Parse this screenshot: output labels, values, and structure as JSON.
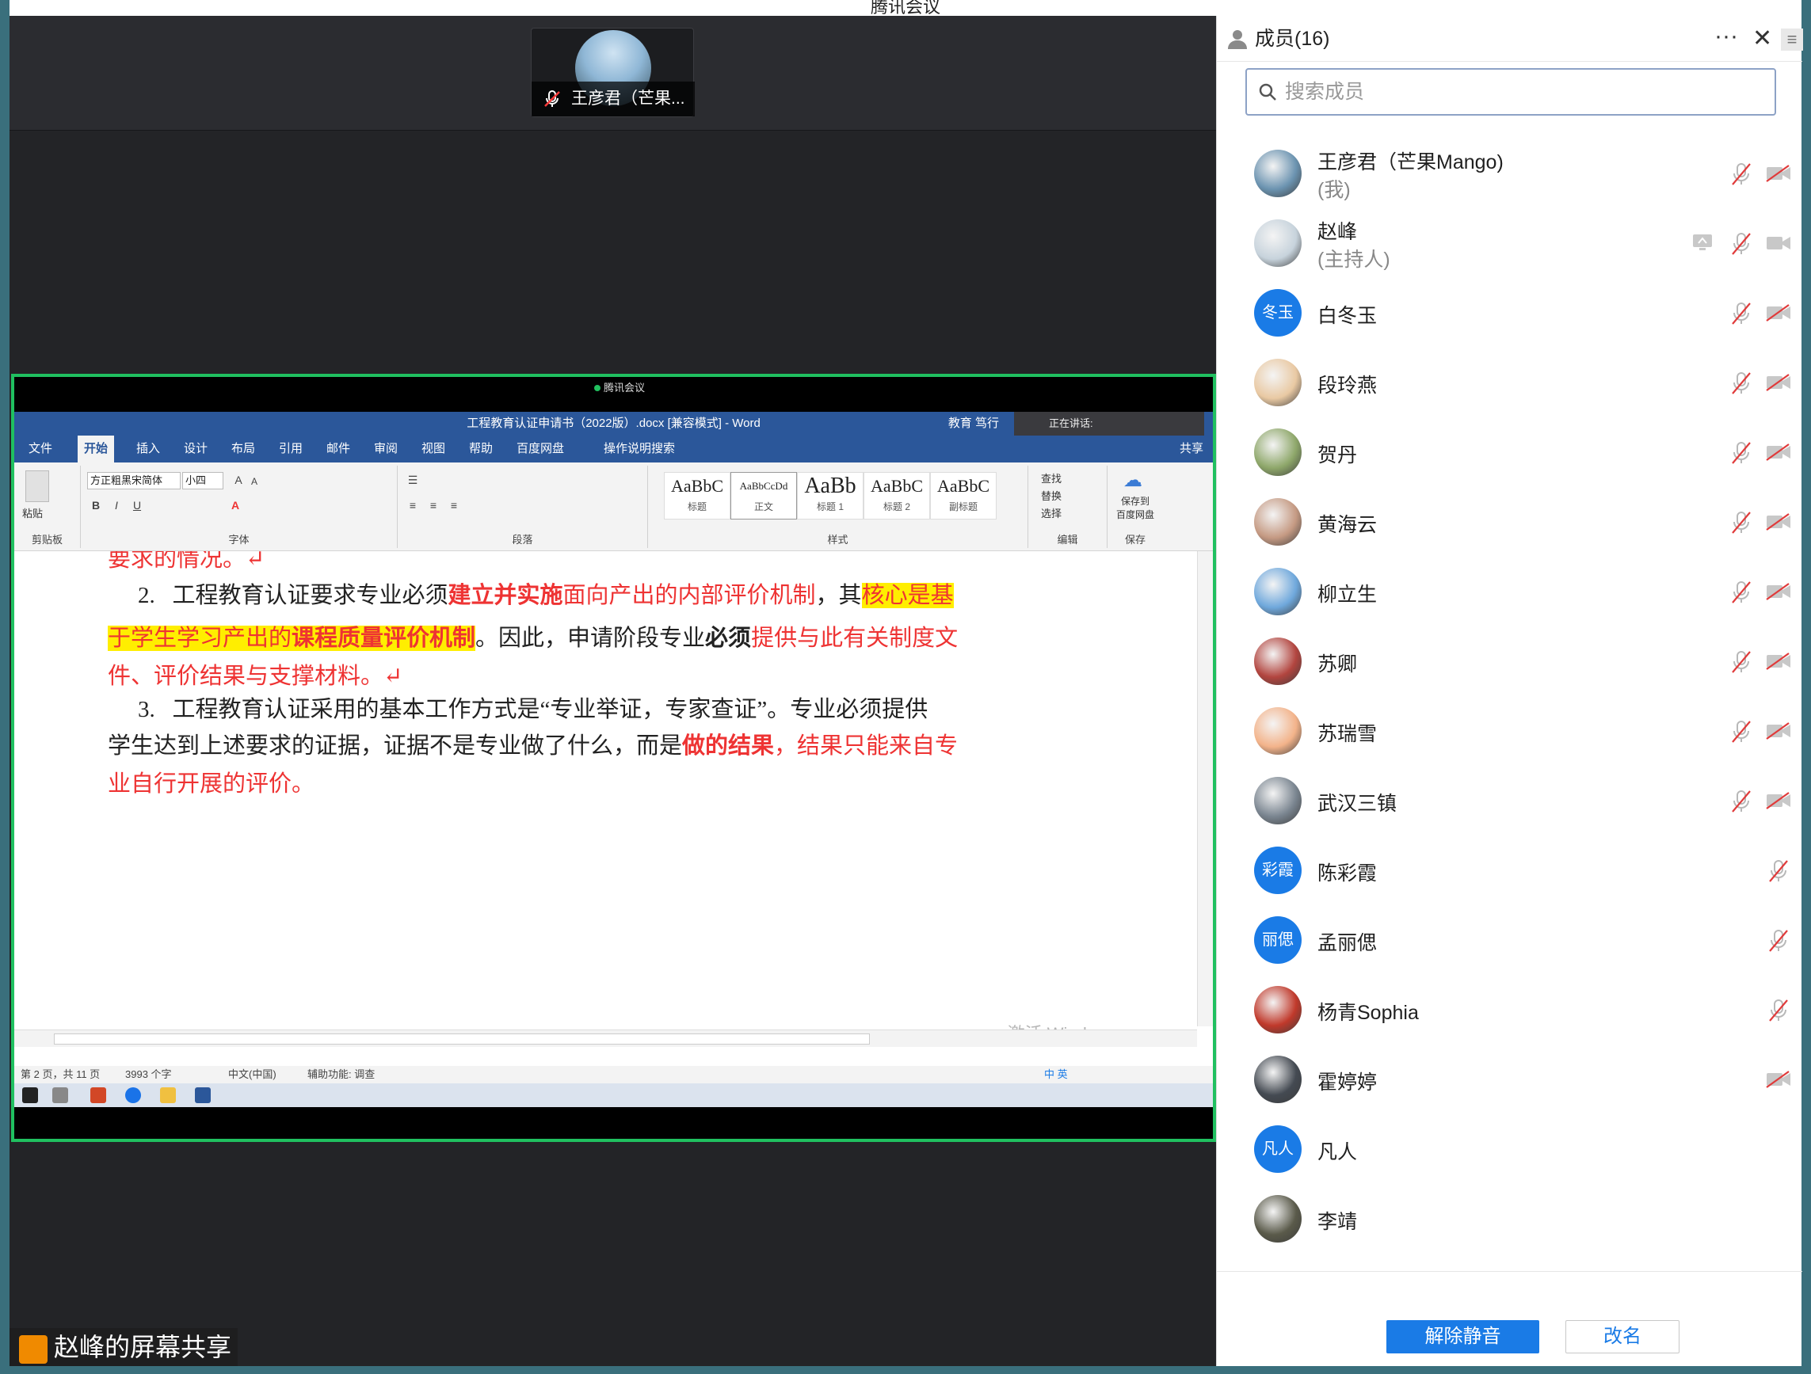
{
  "window": {
    "title": "腾讯会议"
  },
  "video_tile": {
    "name": "王彦君（芒果..."
  },
  "share": {
    "badge": "腾讯会议",
    "word_title": "工程教育认证申请书（2022版）.docx [兼容模式] - Word",
    "word_user": "教育 笃行",
    "speaking": "正在讲话:",
    "tabs": [
      "文件",
      "开始",
      "插入",
      "设计",
      "布局",
      "引用",
      "邮件",
      "审阅",
      "视图",
      "帮助",
      "百度网盘",
      "操作说明搜索"
    ],
    "share_btn": "共享",
    "ribbon": {
      "paste": "粘贴",
      "clipboard": "剪贴板",
      "font_name": "方正粗黑宋简体",
      "font_size": "小四",
      "font_group": "字体",
      "para_group": "段落",
      "styles_group": "样式",
      "edit_group": "编辑",
      "save_group": "保存",
      "styles": [
        {
          "preview": "AaBbC",
          "name": "标题"
        },
        {
          "preview": "AaBbCcDd",
          "name": "正文"
        },
        {
          "preview": "AaBb",
          "name": "标题 1"
        },
        {
          "preview": "AaBbC",
          "name": "标题 2"
        },
        {
          "preview": "AaBbC",
          "name": "副标题"
        }
      ],
      "find": "查找",
      "replace": "替换",
      "select": "选择",
      "save_to": "保存到\n百度网盘"
    },
    "doc": {
      "l0": "要求的情况。↵",
      "l1_num": "2.",
      "l1_a": "工程教育认证要求专业必须",
      "l1_b": "建立并实施",
      "l1_c": "面向产出的内部评价机制",
      "l1_d": "，其",
      "l1_e": "核心是基",
      "l2_a": "于学生学习产出的",
      "l2_b": "课程质量评价机制",
      "l2_c": "。因此，申请阶段专业",
      "l2_d": "必须",
      "l2_e": "提供与此有关制度文",
      "l3": "件、评价结果与支撑材料。↵",
      "l4_num": "3.",
      "l4": "工程教育认证采用的基本工作方式是“专业举证，专家查证”。专业必须提供",
      "l5_a": "学生达到上述要求的证据，证据不是专业做了什么，而是",
      "l5_b": "做的结果",
      "l5_c": "，",
      "l5_d": "结果只能来自专",
      "l6": "业自行开展的评价。"
    },
    "watermark": "激活 Windows",
    "status": {
      "page": "第 2 页，共 11 页",
      "words": "3993 个字",
      "lang": "中文(中国)",
      "access": "辅助功能: 调查"
    },
    "ime": "中 英"
  },
  "share_label": "赵峰的屏幕共享",
  "panel": {
    "title": "成员(16)",
    "more": "···",
    "close": "✕",
    "menu": "≡",
    "search_placeholder": "搜索成员",
    "members": [
      {
        "name": "王彦君（芒果Mango)",
        "sub": "(我)",
        "avatar": "photo",
        "color": "#6b93b0",
        "mic": "off",
        "cam": "off"
      },
      {
        "name": "赵峰",
        "sub": "(主持人)",
        "avatar": "photo",
        "color": "#c7d3dc",
        "mic": "off",
        "cam": "on",
        "screen": true
      },
      {
        "name": "白冬玉",
        "avatar_text": "冬玉",
        "mic": "off",
        "cam": "off"
      },
      {
        "name": "段玲燕",
        "avatar": "photo",
        "color": "#e9c9a3",
        "mic": "off",
        "cam": "off"
      },
      {
        "name": "贺丹",
        "avatar": "photo",
        "color": "#8ea76a",
        "mic": "off",
        "cam": "off"
      },
      {
        "name": "黄海云",
        "avatar": "photo",
        "color": "#c59a83",
        "mic": "off",
        "cam": "off"
      },
      {
        "name": "柳立生",
        "avatar": "photo",
        "color": "#6fa8dc",
        "mic": "off",
        "cam": "off"
      },
      {
        "name": "苏卿",
        "avatar": "photo",
        "color": "#b2453f",
        "mic": "off",
        "cam": "off"
      },
      {
        "name": "苏瑞雪",
        "avatar": "photo",
        "color": "#f3b38a",
        "mic": "off",
        "cam": "off"
      },
      {
        "name": "武汉三镇",
        "avatar": "photo",
        "color": "#7a8590",
        "mic": "off",
        "cam": "off"
      },
      {
        "name": "陈彩霞",
        "avatar_text": "彩霞",
        "mic": "off"
      },
      {
        "name": "孟丽偲",
        "avatar_text": "丽偲",
        "mic": "off"
      },
      {
        "name": "杨青Sophia",
        "avatar": "photo",
        "color": "#c0392b",
        "mic": "off"
      },
      {
        "name": "霍婷婷",
        "avatar": "photo",
        "color": "#444a52",
        "cam": "off"
      },
      {
        "name": "凡人",
        "avatar_text": "凡人"
      },
      {
        "name": "李靖",
        "avatar": "photo",
        "color": "#5a5a4a"
      }
    ],
    "unmute_label": "解除静音",
    "rename_label": "改名"
  }
}
